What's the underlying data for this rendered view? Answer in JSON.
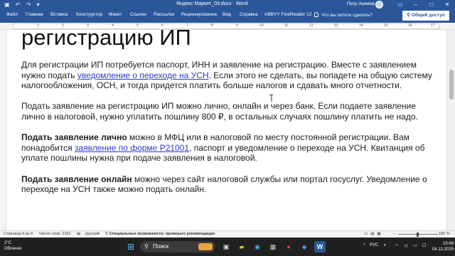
{
  "titlebar": {
    "title": "Яндекс Маркет_03.docx - Word",
    "user": "Петр Акимов",
    "colors": {
      "brand": "#2b579a"
    }
  },
  "ribbon": {
    "tabs": [
      "Файл",
      "Главная",
      "Вставка",
      "Конструктор",
      "Макет",
      "Ссылки",
      "Рассылки",
      "Рецензирование",
      "Вид",
      "Справка",
      "ABBYY FineReader 12"
    ],
    "tell_me": "Что вы хотите сделать?",
    "share": "Общий доступ"
  },
  "ruler": {
    "numbers": [
      "1",
      "2",
      "3",
      "4",
      "5",
      "6",
      "7",
      "8",
      "9",
      "10",
      "11",
      "12",
      "13",
      "14",
      "15",
      "16",
      "17"
    ]
  },
  "document": {
    "heading": "регистрацию ИП",
    "p1_a": "Для регистрации ИП потребуется паспорт, ИНН и заявление на регистрацию. Вместе с заявлением нужно подать ",
    "p1_link": "уведомление о переходе на УСН",
    "p1_b": ". Если этого не сделать, вы попадете на общую систему налогообложения, ОСН, и тогда придется платить больше налогов и сдавать много отчетности.",
    "p2": "Подать заявление на регистрацию ИП можно лично, онлайн и через банк. Если подаете заявление лично в налоговой, нужно уплатить пошлину 800 ₽, в остальных случаях пошлину платить не надо.",
    "p3_bold": "Подать заявление лично",
    "p3_a": " можно в МФЦ или в налоговой по месту постоянной регистрации. Вам понадобится ",
    "p3_link": "заявление по форме Р21001",
    "p3_b": ", паспорт и уведомление о переходе на УСН. Квитанция об уплате пошлины нужна при подаче заявления в налоговой.",
    "p4_bold": "Подать заявление онлайн",
    "p4_a": " можно через сайт налоговой службы или портал госуслуг. Уведомление о переходе на УСН также можно подать онлайн."
  },
  "status": {
    "page": "Страница 6 из 9",
    "words": "Число слов: 2191",
    "language": "русский",
    "accessibility": "Специальные возможности: проверьте рекомендации",
    "zoom": "180 %"
  },
  "taskbar": {
    "temperature": "2°C",
    "weather": "Облачно",
    "search": "Поиск",
    "lang": "РУС",
    "time": "10:48",
    "date": "04.12.2025"
  }
}
